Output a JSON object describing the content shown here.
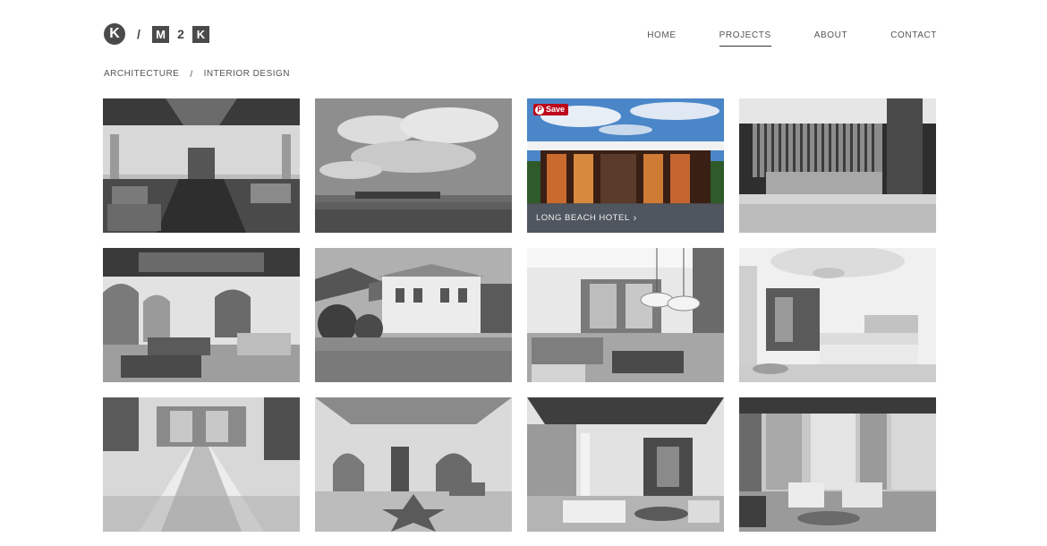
{
  "logo": {
    "left_letter": "K",
    "separator": "/",
    "box_letter_1": "M",
    "number": "2",
    "box_letter_2": "K"
  },
  "nav": {
    "items": [
      {
        "label": "HOME",
        "active": false
      },
      {
        "label": "PROJECTS",
        "active": true
      },
      {
        "label": "ABOUT",
        "active": false
      },
      {
        "label": "CONTACT",
        "active": false
      }
    ]
  },
  "filters": {
    "items": [
      "ARCHITECTURE",
      "INTERIOR DESIGN"
    ],
    "separator": "/"
  },
  "gallery": {
    "hover_caption": "LONG BEACH HOTEL",
    "caption_chevron": "›",
    "save_button": {
      "label": "Save",
      "pin": "P",
      "color": "#bd081c"
    }
  }
}
